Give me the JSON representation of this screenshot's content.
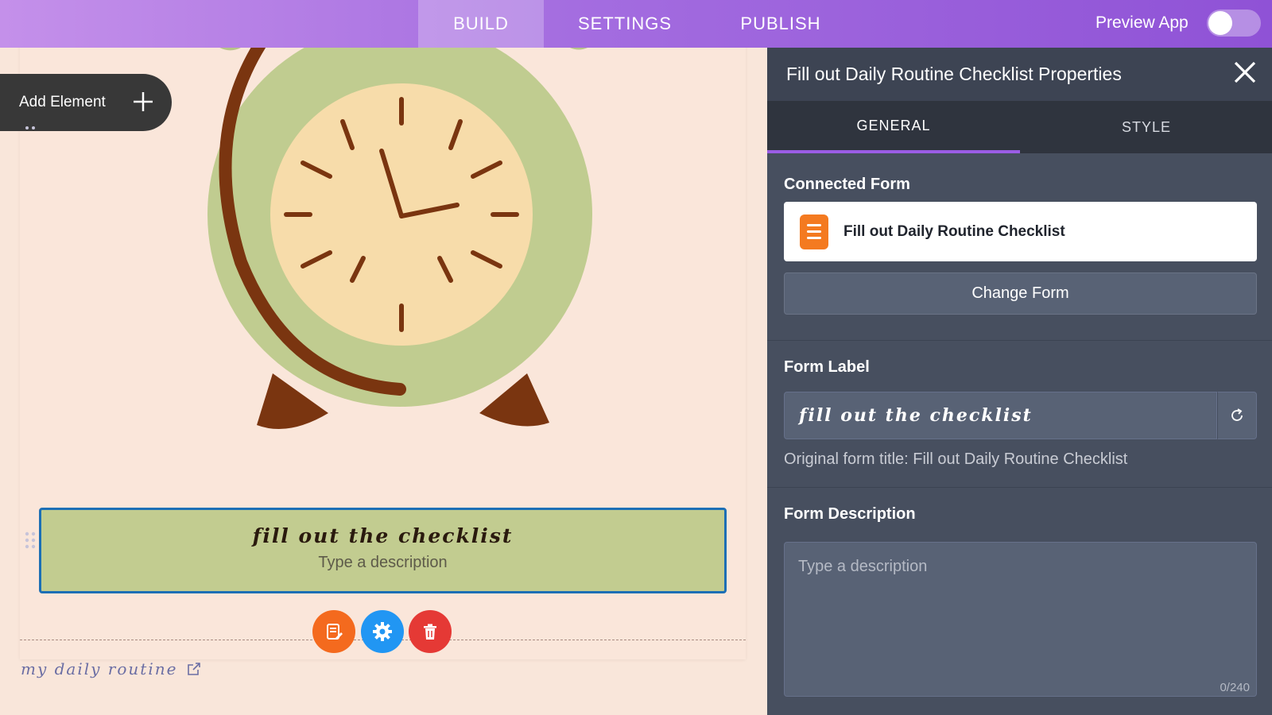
{
  "topbar": {
    "tabs": [
      {
        "label": "BUILD",
        "active": true
      },
      {
        "label": "SETTINGS",
        "active": false
      },
      {
        "label": "PUBLISH",
        "active": false
      }
    ],
    "preview_label": "Preview App",
    "preview_enabled": false
  },
  "canvas": {
    "add_element_label": "Add Element",
    "form_block": {
      "title": "fill out the checklist",
      "description": "Type a description"
    },
    "action_buttons": [
      {
        "name": "edit-form-icon",
        "color": "#f46a1e"
      },
      {
        "name": "gear-icon",
        "color": "#2196f3"
      },
      {
        "name": "trash-icon",
        "color": "#e53935"
      }
    ],
    "page_label": "my daily routine"
  },
  "panel": {
    "title": "Fill out Daily Routine Checklist Properties",
    "tabs": [
      {
        "label": "GENERAL",
        "active": true
      },
      {
        "label": "STYLE",
        "active": false
      }
    ],
    "connected_form": {
      "label": "Connected Form",
      "form_name": "Fill out Daily Routine Checklist",
      "change_button": "Change Form"
    },
    "form_label": {
      "label": "Form Label",
      "value": "fill out the checklist",
      "hint": "Original form title: Fill out Daily Routine Checklist"
    },
    "form_description": {
      "label": "Form Description",
      "placeholder": "Type a description",
      "counter": "0/240"
    }
  },
  "colors": {
    "accent": "#9b5de5",
    "form_block_bg": "#c2cc90",
    "form_block_border": "#1c6fb5",
    "canvas_bg": "#f9e6da",
    "panel_bg": "#474f5f"
  }
}
